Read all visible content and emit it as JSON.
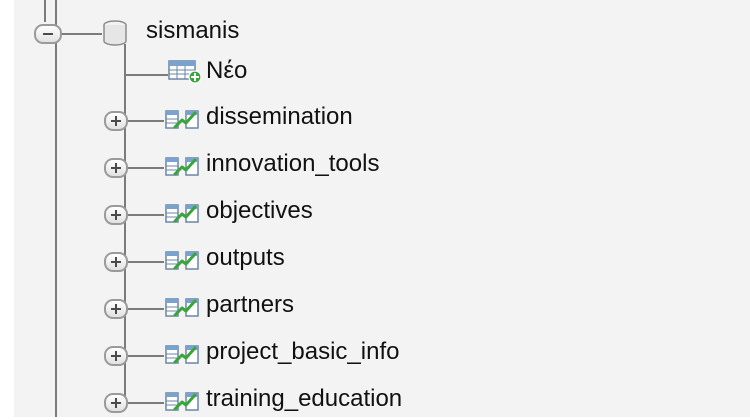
{
  "tree": {
    "database": {
      "name": "sismanis",
      "icon": "database-icon"
    },
    "new_item": {
      "label": "Νέο",
      "icon": "new-table-icon"
    },
    "tables": [
      {
        "name": "dissemination",
        "icon": "table-icon"
      },
      {
        "name": "innovation_tools",
        "icon": "table-icon"
      },
      {
        "name": "objectives",
        "icon": "table-icon"
      },
      {
        "name": "outputs",
        "icon": "table-icon"
      },
      {
        "name": "partners",
        "icon": "table-icon"
      },
      {
        "name": "project_basic_info",
        "icon": "table-icon"
      },
      {
        "name": "training_education",
        "icon": "table-icon"
      }
    ]
  },
  "colors": {
    "panel_background": "#f3f3f3",
    "tree_line": "#7b7b7b",
    "icon_green": "#3aa53a",
    "icon_blue": "#3b7fc4"
  }
}
